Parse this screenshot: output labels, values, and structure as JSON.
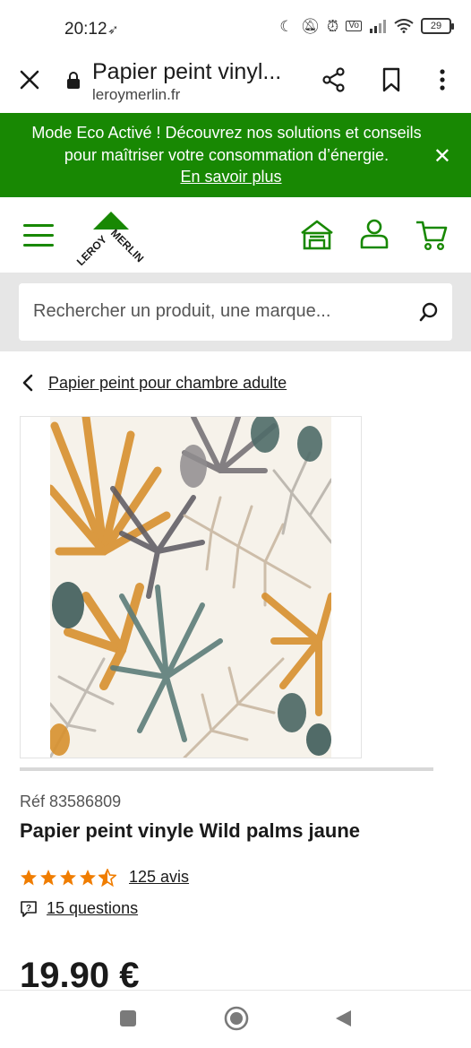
{
  "statusbar": {
    "time": "20:12",
    "battery": "29",
    "icons": [
      "moon-icon",
      "bell-off-icon",
      "alarm-icon",
      "volte-icon",
      "signal-icon",
      "wifi-icon"
    ]
  },
  "browser": {
    "page_title": "Papier peint vinyl...",
    "url": "leroymerlin.fr",
    "icons": [
      "close-icon",
      "lock-icon",
      "share-icon",
      "bookmark-icon",
      "more-vert-icon"
    ]
  },
  "eco_banner": {
    "line1": "Mode Eco Activé ! Découvrez nos solutions et conseils",
    "line2": "pour maîtriser votre consommation d’énergie.",
    "link": "En savoir plus",
    "close": "✕",
    "color": "#188803"
  },
  "header": {
    "logo_text_1": "LEROY",
    "logo_text_2": "MERLIN",
    "icons": [
      "menu-icon",
      "store-icon",
      "account-icon",
      "cart-icon"
    ]
  },
  "search": {
    "placeholder": "Rechercher un produit, une marque..."
  },
  "breadcrumb": {
    "label": "Papier peint pour chambre adulte"
  },
  "product": {
    "ref": "Réf 83586809",
    "title": "Papier peint vinyle Wild palms jaune",
    "rating": 4.5,
    "rating_max": 5,
    "reviews": "125 avis",
    "questions": "15 questions",
    "price": "19.90 €"
  },
  "colors": {
    "brand_green": "#188803",
    "star": "#f07d00"
  }
}
